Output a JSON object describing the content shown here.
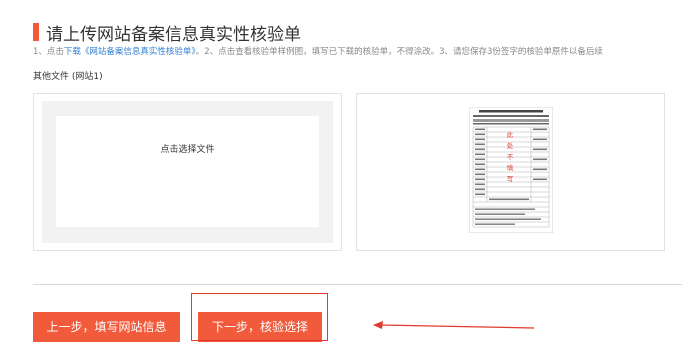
{
  "header": {
    "title": "请上传网站备案信息真实性核验单",
    "instructions": {
      "prefix": "1、点击",
      "link": "下载《网站备案信息真实性核验单》",
      "suffix": "。2、点击查看核验单样例图，填写已下载的核验单，不得涂改。3、请您保存3份签字的核验单原件以备后续"
    }
  },
  "section": {
    "label": "其他文件 (网站1)"
  },
  "upload": {
    "prompt": "点击选择文件"
  },
  "sample": {
    "stamp_lines": [
      "此",
      "处",
      "不",
      "填",
      "写"
    ]
  },
  "footer": {
    "prev_label": "上一步，填写网站信息",
    "next_label": "下一步，核验选择"
  },
  "colors": {
    "accent": "#f25a3c",
    "annotation": "#e23a2c",
    "link": "#2f7fd0"
  }
}
